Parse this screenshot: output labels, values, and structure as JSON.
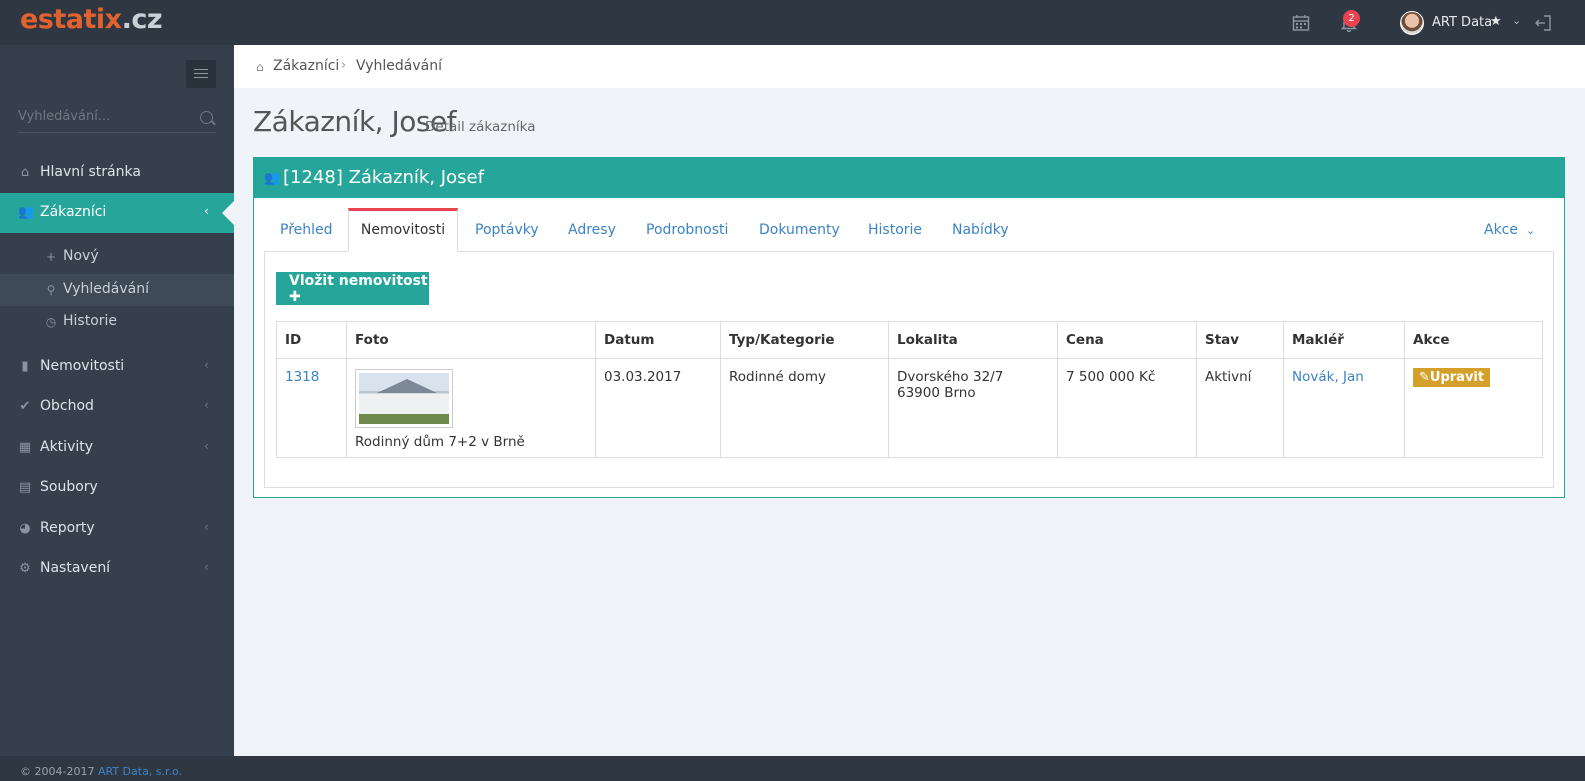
{
  "brand": {
    "part1": "estatix",
    "part2": ".cz"
  },
  "topbar": {
    "notifications_count": "2",
    "user_name": "ART Data"
  },
  "sidebar": {
    "search_placeholder": "Vyhledávání...",
    "items": [
      {
        "label": "Hlavní stránka",
        "icon": "home-icon"
      },
      {
        "label": "Zákazníci",
        "icon": "users-icon",
        "active": true
      },
      {
        "label": "Nemovitosti",
        "icon": "building-icon"
      },
      {
        "label": "Obchod",
        "icon": "check-circle-icon"
      },
      {
        "label": "Aktivity",
        "icon": "calendar-icon"
      },
      {
        "label": "Soubory",
        "icon": "file-icon"
      },
      {
        "label": "Reporty",
        "icon": "dashboard-icon"
      },
      {
        "label": "Nastavení",
        "icon": "gear-icon"
      }
    ],
    "subitems": [
      {
        "label": "Nový",
        "icon": "plus-icon"
      },
      {
        "label": "Vyhledávání",
        "icon": "search-icon",
        "current": true
      },
      {
        "label": "Historie",
        "icon": "clock-icon"
      }
    ]
  },
  "breadcrumb": {
    "item1": "Zákazníci",
    "item2": "Vyhledávání"
  },
  "page": {
    "title": "Zákazník, Josef",
    "subtitle": "Detail zákazníka"
  },
  "panel": {
    "heading": "[1248] Zákazník, Josef",
    "tabs": [
      "Přehled",
      "Nemovitosti",
      "Poptávky",
      "Adresy",
      "Podrobnosti",
      "Dokumenty",
      "Historie",
      "Nabídky"
    ],
    "active_tab": "Nemovitosti",
    "actions_label": "Akce",
    "add_button": "Vložit nemovitost",
    "table": {
      "headers": [
        "ID",
        "Foto",
        "Datum",
        "Typ/Kategorie",
        "Lokalita",
        "Cena",
        "Stav",
        "Makléř",
        "Akce"
      ],
      "rows": [
        {
          "id": "1318",
          "photo_caption": "Rodinný dům 7+2 v Brně",
          "date": "03.03.2017",
          "type": "Rodinné domy",
          "street": "Dvorského 32/7",
          "city": "63900 Brno",
          "price": "7 500 000 Kč",
          "status": "Aktivní",
          "agent": "Novák, Jan",
          "action": "Upravit"
        }
      ]
    }
  },
  "footer": {
    "copyright": "© 2004-2017",
    "company": "ART Data, s.r.o."
  },
  "colors": {
    "accent": "#26a69a",
    "brand": "#e2622f",
    "alert": "#e9434f",
    "warning": "#d4a02a",
    "link": "#3c83c4"
  }
}
